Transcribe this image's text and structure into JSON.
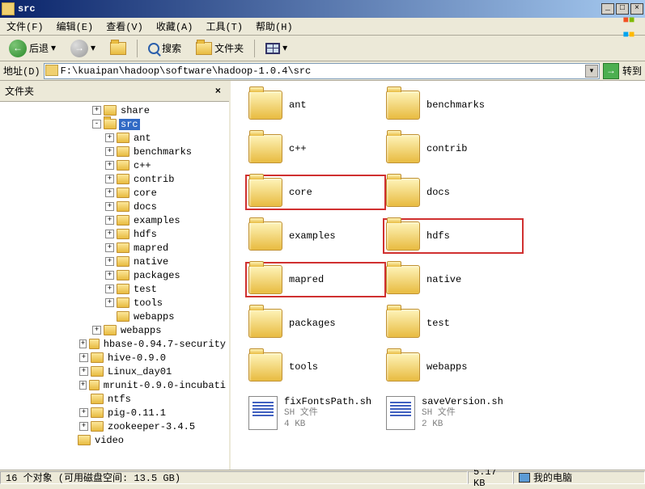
{
  "window": {
    "title": "src"
  },
  "window_controls": {
    "min": "_",
    "max": "□",
    "close": "×"
  },
  "menu": {
    "file": "文件(F)",
    "edit": "编辑(E)",
    "view": "查看(V)",
    "favorites": "收藏(A)",
    "tools": "工具(T)",
    "help": "帮助(H)"
  },
  "toolbar": {
    "back": "后退",
    "search": "搜索",
    "folders": "文件夹"
  },
  "address": {
    "label": "地址(D)",
    "value": "F:\\kuaipan\\hadoop\\software\\hadoop-1.0.4\\src",
    "go": "转到"
  },
  "sidebar": {
    "title": "文件夹",
    "tree": [
      {
        "indent": 7,
        "exp": "+",
        "label": "share"
      },
      {
        "indent": 7,
        "exp": "-",
        "label": "src",
        "selected": true,
        "open": true
      },
      {
        "indent": 8,
        "exp": "+",
        "label": "ant"
      },
      {
        "indent": 8,
        "exp": "+",
        "label": "benchmarks"
      },
      {
        "indent": 8,
        "exp": "+",
        "label": "c++"
      },
      {
        "indent": 8,
        "exp": "+",
        "label": "contrib"
      },
      {
        "indent": 8,
        "exp": "+",
        "label": "core"
      },
      {
        "indent": 8,
        "exp": "+",
        "label": "docs"
      },
      {
        "indent": 8,
        "exp": "+",
        "label": "examples"
      },
      {
        "indent": 8,
        "exp": "+",
        "label": "hdfs"
      },
      {
        "indent": 8,
        "exp": "+",
        "label": "mapred"
      },
      {
        "indent": 8,
        "exp": "+",
        "label": "native"
      },
      {
        "indent": 8,
        "exp": "+",
        "label": "packages"
      },
      {
        "indent": 8,
        "exp": "+",
        "label": "test"
      },
      {
        "indent": 8,
        "exp": "+",
        "label": "tools"
      },
      {
        "indent": 8,
        "exp": "",
        "label": "webapps"
      },
      {
        "indent": 7,
        "exp": "+",
        "label": "webapps"
      },
      {
        "indent": 6,
        "exp": "+",
        "label": "hbase-0.94.7-security"
      },
      {
        "indent": 6,
        "exp": "+",
        "label": "hive-0.9.0"
      },
      {
        "indent": 6,
        "exp": "+",
        "label": "Linux_day01"
      },
      {
        "indent": 6,
        "exp": "+",
        "label": "mrunit-0.9.0-incubati"
      },
      {
        "indent": 6,
        "exp": "",
        "label": "ntfs"
      },
      {
        "indent": 6,
        "exp": "+",
        "label": "pig-0.11.1"
      },
      {
        "indent": 6,
        "exp": "+",
        "label": "zookeeper-3.4.5"
      },
      {
        "indent": 5,
        "exp": "",
        "label": "video"
      }
    ]
  },
  "content": {
    "items": [
      {
        "type": "folder",
        "name": "ant"
      },
      {
        "type": "folder",
        "name": "benchmarks"
      },
      {
        "type": "folder",
        "name": "c++"
      },
      {
        "type": "folder",
        "name": "contrib"
      },
      {
        "type": "folder",
        "name": "core",
        "hl": true
      },
      {
        "type": "folder",
        "name": "docs"
      },
      {
        "type": "folder",
        "name": "examples"
      },
      {
        "type": "folder",
        "name": "hdfs",
        "hl": true
      },
      {
        "type": "folder",
        "name": "mapred",
        "hl": true
      },
      {
        "type": "folder",
        "name": "native"
      },
      {
        "type": "folder",
        "name": "packages"
      },
      {
        "type": "folder",
        "name": "test"
      },
      {
        "type": "folder",
        "name": "tools"
      },
      {
        "type": "folder",
        "name": "webapps"
      },
      {
        "type": "file",
        "name": "fixFontsPath.sh",
        "ftype": "SH 文件",
        "size": "4 KB"
      },
      {
        "type": "file",
        "name": "saveVersion.sh",
        "ftype": "SH 文件",
        "size": "2 KB"
      }
    ]
  },
  "status": {
    "left": "16 个对象 (可用磁盘空间: 13.5 GB)",
    "mid": "5.17 KB",
    "right": "我的电脑"
  }
}
